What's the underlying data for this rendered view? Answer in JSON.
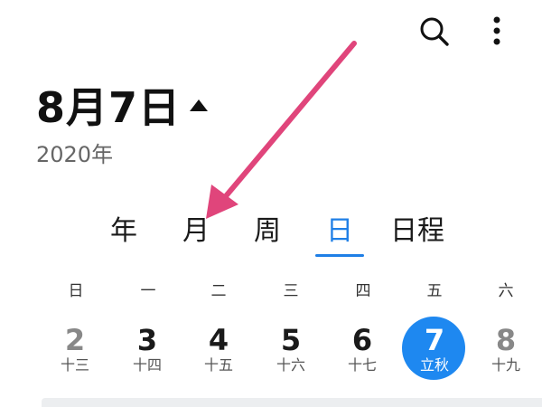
{
  "header": {
    "date_title": "8月7日",
    "year": "2020年"
  },
  "toolbar": {
    "search_icon": "search-icon",
    "more_icon": "more-vertical-icon"
  },
  "tabs": [
    {
      "label": "年",
      "active": false
    },
    {
      "label": "月",
      "active": false
    },
    {
      "label": "周",
      "active": false
    },
    {
      "label": "日",
      "active": true
    },
    {
      "label": "日程",
      "active": false
    }
  ],
  "weekdays": [
    "日",
    "一",
    "二",
    "三",
    "四",
    "五",
    "六"
  ],
  "days": [
    {
      "num": "2",
      "lunar": "十三",
      "dim": true
    },
    {
      "num": "3",
      "lunar": "十四"
    },
    {
      "num": "4",
      "lunar": "十五"
    },
    {
      "num": "5",
      "lunar": "十六"
    },
    {
      "num": "6",
      "lunar": "十七"
    },
    {
      "num": "7",
      "lunar": "立秋",
      "selected": true
    },
    {
      "num": "8",
      "lunar": "十九",
      "dim": true
    }
  ],
  "colors": {
    "accent": "#1f7fe6",
    "selected_circle": "#1e88f0",
    "annotation_arrow": "#e0457b"
  }
}
